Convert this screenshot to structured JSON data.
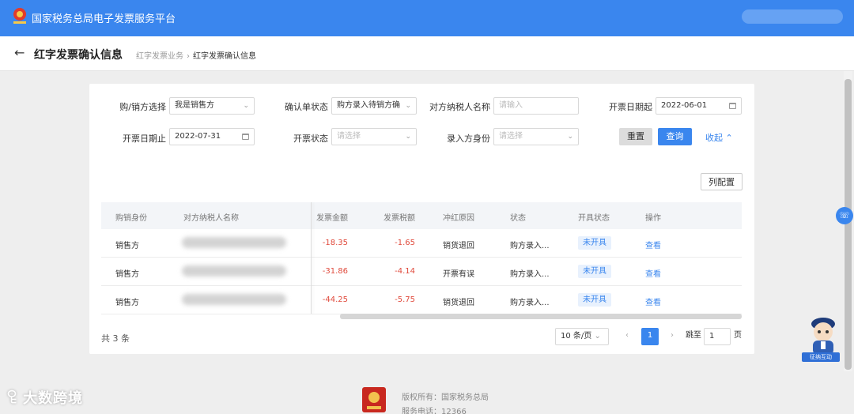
{
  "header": {
    "app_title": "国家税务总局电子发票服务平台",
    "emblem_icon": "tax-emblem-icon"
  },
  "titlebar": {
    "page_title": "红字发票确认信息",
    "breadcrumb": [
      "红字发票业务",
      "红字发票确认信息"
    ]
  },
  "filters": {
    "party_select": {
      "label": "购/销方选择",
      "value": "我是销售方"
    },
    "confirm_status": {
      "label": "确认单状态",
      "value": "购方录入待销方确"
    },
    "counterparty_name": {
      "label": "对方纳税人名称",
      "placeholder": "请输入"
    },
    "date_from": {
      "label": "开票日期起",
      "value": "2022-06-01"
    },
    "date_to": {
      "label": "开票日期止",
      "value": "2022-07-31"
    },
    "issue_status": {
      "label": "开票状态",
      "placeholder": "请选择"
    },
    "entry_identity": {
      "label": "录入方身份",
      "placeholder": "请选择"
    },
    "reset_label": "重置",
    "query_label": "查询",
    "collapse_label": "收起"
  },
  "config_label": "列配置",
  "table": {
    "headers": [
      "购销身份",
      "对方纳税人名称",
      "发票金额",
      "发票税额",
      "冲红原因",
      "状态",
      "开具状态",
      "操作"
    ],
    "rows": [
      {
        "identity": "销售方",
        "amount": "-18.35",
        "tax": "-1.65",
        "reason": "销货退回",
        "status": "购方录入...",
        "issue_status": "未开具",
        "action": "查看"
      },
      {
        "identity": "销售方",
        "amount": "-31.86",
        "tax": "-4.14",
        "reason": "开票有误",
        "status": "购方录入...",
        "issue_status": "未开具",
        "action": "查看"
      },
      {
        "identity": "销售方",
        "amount": "-44.25",
        "tax": "-5.75",
        "reason": "销货退回",
        "status": "购方录入...",
        "issue_status": "未开具",
        "action": "查看"
      }
    ]
  },
  "pagination": {
    "total": "共 3 条",
    "page_size": "10 条/页",
    "current_page": "1",
    "jump_label": "跳至",
    "jump_value": "1",
    "page_suffix": "页"
  },
  "side": {
    "mascot_label": "征纳互动"
  },
  "footer": {
    "copyright": "版权所有：国家税务总局",
    "phone": "服务电话：12366"
  },
  "watermark": "大数跨境",
  "colors": {
    "primary": "#3a86ee",
    "negative": "#e04a3c"
  }
}
